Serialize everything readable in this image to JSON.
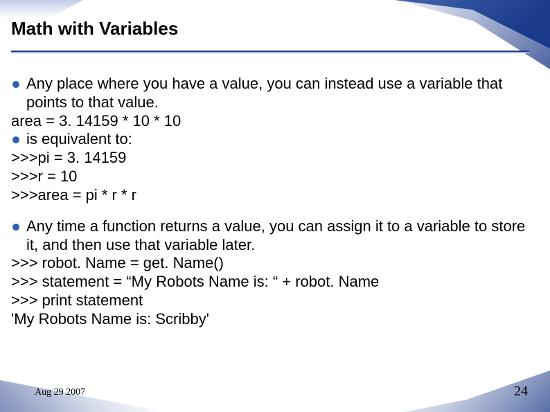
{
  "title": "Math with Variables",
  "block1": {
    "bullet1": "Any place where you have a value, you can instead use a variable that points to that value.",
    "line1": "area = 3. 14159 * 10 * 10",
    "bullet2": "is equivalent to:",
    "line2": ">>>pi = 3. 14159",
    "line3": ">>>r = 10",
    "line4": ">>>area = pi * r * r"
  },
  "block2": {
    "bullet1": "Any time a function returns a value, you can assign it to a variable to store it, and then use that variable later.",
    "line1": ">>> robot. Name = get. Name()",
    "line2": ">>> statement = “My Robots Name is: “ + robot. Name",
    "line3": ">>> print statement",
    "line4": "'My Robots Name is: Scribby'"
  },
  "footer_date": "Aug 29 2007",
  "page_number": "24"
}
